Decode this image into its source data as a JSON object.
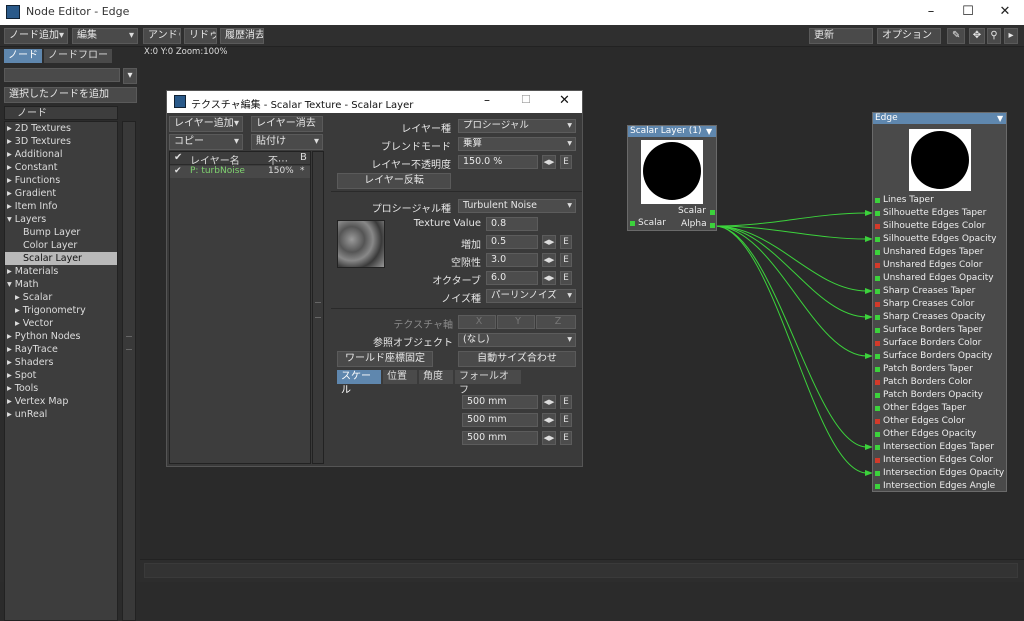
{
  "window": {
    "title": "Node Editor - Edge"
  },
  "toolbar": {
    "add_node": "ノード追加",
    "edit": "編集",
    "undo": "アンドゥ",
    "redo": "リドゥ",
    "clear_history": "履歴消去",
    "update": "更新",
    "options": "オプション"
  },
  "leftpanel": {
    "tab_node": "ノード",
    "tab_nodeflow": "ノードフロー",
    "add_selected": "選択したノードを追加",
    "list_header": "ノード",
    "categories": [
      {
        "label": "▸ 2D Textures"
      },
      {
        "label": "▸ 3D Textures"
      },
      {
        "label": "▸ Additional"
      },
      {
        "label": "▸ Constant"
      },
      {
        "label": "▸ Functions"
      },
      {
        "label": "▸ Gradient"
      },
      {
        "label": "▸ Item Info"
      },
      {
        "label": "▾ Layers"
      },
      {
        "label": "Bump Layer"
      },
      {
        "label": "Color Layer"
      },
      {
        "label": "Scalar Layer",
        "selected": true
      },
      {
        "label": "▸ Materials"
      },
      {
        "label": "▾ Math"
      },
      {
        "label": "▸ Scalar"
      },
      {
        "label": "▸ Trigonometry"
      },
      {
        "label": "▸ Vector"
      },
      {
        "label": "▸ Python Nodes"
      },
      {
        "label": "▸ RayTrace"
      },
      {
        "label": "▸ Shaders"
      },
      {
        "label": "▸ Spot"
      },
      {
        "label": "▸ Tools"
      },
      {
        "label": "▸ Vertex Map"
      },
      {
        "label": "▸ unReal"
      }
    ]
  },
  "canvas": {
    "status": "X:0 Y:0 Zoom:100%"
  },
  "texture_editor": {
    "title": "テクスチャ編集 - Scalar Texture - Scalar Layer",
    "add_layer": "レイヤー追加",
    "delete_layer": "レイヤー消去",
    "copy": "コピー",
    "paste": "貼付け",
    "col_name": "レイヤー名",
    "col_opacity": "不⋯",
    "col_blend": "B",
    "layer_name": "P: turbNoise",
    "layer_opacity": "150%",
    "layer_blend": "*",
    "layer_type_label": "レイヤー種",
    "layer_type": "プロシージャル",
    "blend_mode_label": "ブレンドモード",
    "blend_mode": "乗算",
    "opacity_label": "レイヤー不透明度",
    "opacity": "150.0 %",
    "invert_layer": "レイヤー反転",
    "proc_type_label": "プロシージャル種",
    "proc_type": "Turbulent Noise",
    "tex_value_label": "Texture Value",
    "tex_value": "0.8",
    "increment_label": "増加",
    "increment": "0.5",
    "lacunarity_label": "空隙性",
    "lacunarity": "3.0",
    "octaves_label": "オクターブ",
    "octaves": "6.0",
    "noise_type_label": "ノイズ種",
    "noise_type": "パーリンノイズ",
    "tex_axis_label": "テクスチャ軸",
    "axis_x": "X",
    "axis_y": "Y",
    "axis_z": "Z",
    "ref_object_label": "参照オブジェクト",
    "ref_object": "(なし)",
    "world_coords": "ワールド座標固定",
    "auto_size": "自動サイズ合わせ",
    "tabs": [
      "スケール",
      "位置",
      "角度",
      "フォールオフ"
    ],
    "x_label": "X",
    "y_label": "Y",
    "z_label": "Z",
    "scale_x": "500 mm",
    "scale_y": "500 mm",
    "scale_z": "500 mm",
    "e": "E"
  },
  "scalar_node": {
    "title": "Scalar Layer (1)",
    "in_port": "Scalar",
    "out_scalar": "Scalar",
    "out_alpha": "Alpha"
  },
  "edge_node": {
    "title": "Edge",
    "inputs": [
      {
        "label": "Lines Taper",
        "type": "g"
      },
      {
        "label": "Silhouette Edges Taper",
        "type": "g"
      },
      {
        "label": "Silhouette Edges Color",
        "type": "r"
      },
      {
        "label": "Silhouette Edges Opacity",
        "type": "g"
      },
      {
        "label": "Unshared Edges Taper",
        "type": "g"
      },
      {
        "label": "Unshared Edges Color",
        "type": "r"
      },
      {
        "label": "Unshared Edges Opacity",
        "type": "g"
      },
      {
        "label": "Sharp Creases Taper",
        "type": "g"
      },
      {
        "label": "Sharp Creases Color",
        "type": "r"
      },
      {
        "label": "Sharp Creases Opacity",
        "type": "g"
      },
      {
        "label": "Surface Borders Taper",
        "type": "g"
      },
      {
        "label": "Surface Borders Color",
        "type": "r"
      },
      {
        "label": "Surface Borders Opacity",
        "type": "g"
      },
      {
        "label": "Patch Borders Taper",
        "type": "g"
      },
      {
        "label": "Patch Borders Color",
        "type": "r"
      },
      {
        "label": "Patch Borders Opacity",
        "type": "g"
      },
      {
        "label": "Other Edges Taper",
        "type": "g"
      },
      {
        "label": "Other Edges Color",
        "type": "r"
      },
      {
        "label": "Other Edges Opacity",
        "type": "g"
      },
      {
        "label": "Intersection Edges Taper",
        "type": "g"
      },
      {
        "label": "Intersection Edges Color",
        "type": "r"
      },
      {
        "label": "Intersection Edges Opacity",
        "type": "g"
      },
      {
        "label": "Intersection Edges Angle",
        "type": "g"
      }
    ],
    "connected": [
      1,
      3,
      7,
      9,
      12,
      19,
      21
    ]
  },
  "colors": {
    "accent": "#5f87ae",
    "wire": "#3cd23c",
    "selection": "#b9b9b9"
  }
}
